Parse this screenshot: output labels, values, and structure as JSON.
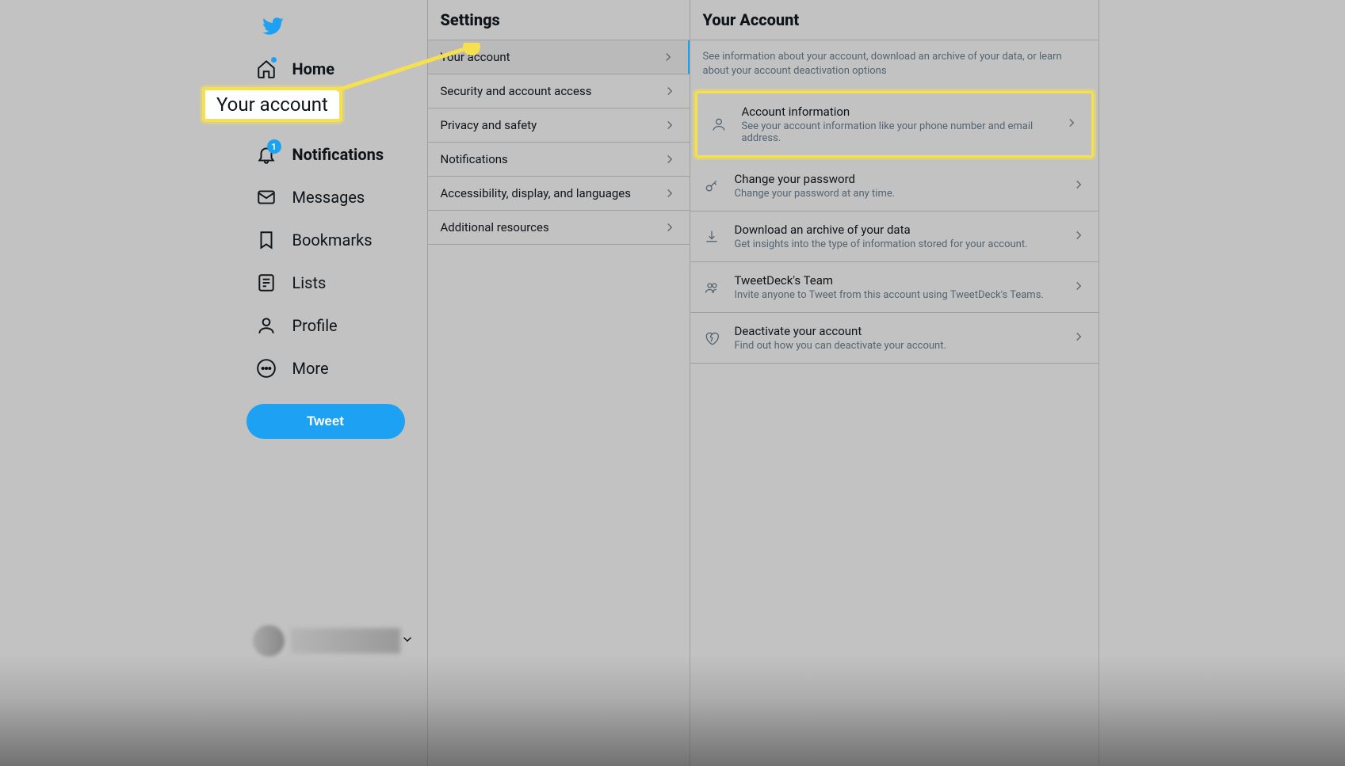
{
  "nav": {
    "home": "Home",
    "notifications": "Notifications",
    "notif_badge": "1",
    "messages": "Messages",
    "bookmarks": "Bookmarks",
    "lists": "Lists",
    "profile": "Profile",
    "more": "More"
  },
  "tweet_button": "Tweet",
  "settings": {
    "title": "Settings",
    "items": {
      "your_account": "Your account",
      "security": "Security and account access",
      "privacy": "Privacy and safety",
      "notifications": "Notifications",
      "accessibility": "Accessibility, display, and languages",
      "additional": "Additional resources"
    }
  },
  "account": {
    "title": "Your Account",
    "description": "See information about your account, download an archive of your data, or learn about your account deactivation options",
    "items": [
      {
        "title": "Account information",
        "sub": "See your account information like your phone number and email address."
      },
      {
        "title": "Change your password",
        "sub": "Change your password at any time."
      },
      {
        "title": "Download an archive of your data",
        "sub": "Get insights into the type of information stored for your account."
      },
      {
        "title": "TweetDeck's Team",
        "sub": "Invite anyone to Tweet from this account using TweetDeck's Teams."
      },
      {
        "title": "Deactivate your account",
        "sub": "Find out how you can deactivate your account."
      }
    ]
  },
  "callout": {
    "text": "Your account"
  }
}
